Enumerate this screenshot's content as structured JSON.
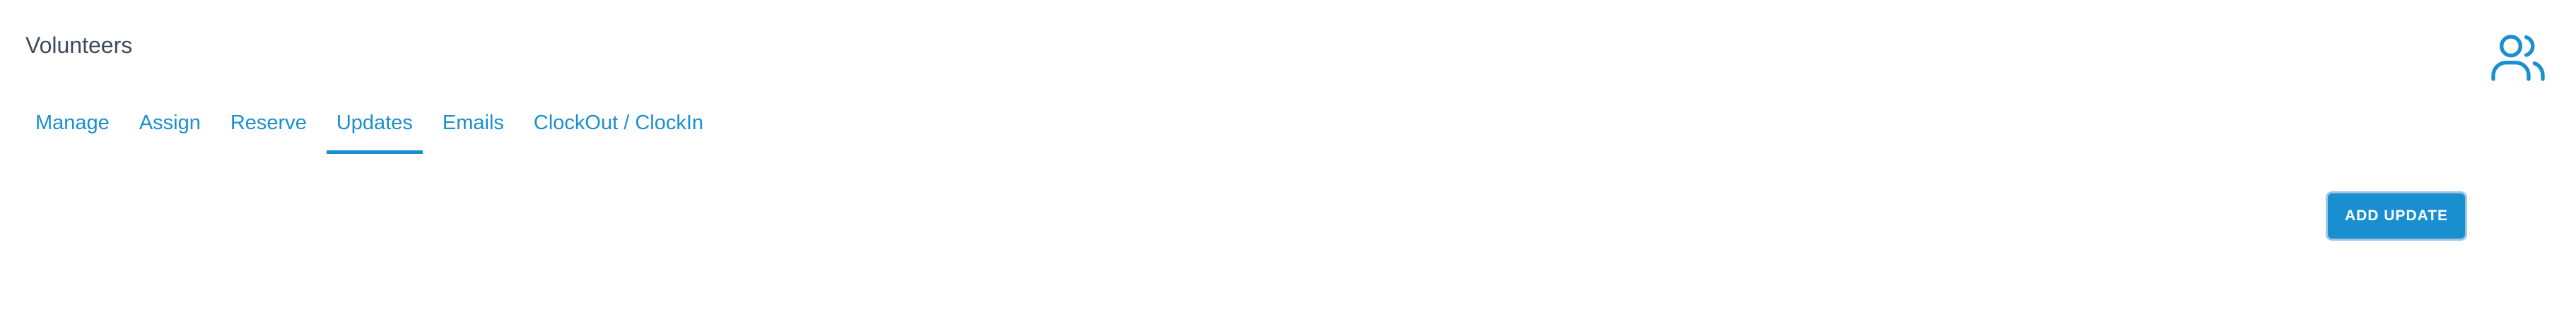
{
  "header": {
    "title": "Volunteers",
    "icon": "users-icon",
    "accent_color": "#1a8fd0"
  },
  "tabs": [
    {
      "label": "Manage",
      "active": false
    },
    {
      "label": "Assign",
      "active": false
    },
    {
      "label": "Reserve",
      "active": false
    },
    {
      "label": "Updates",
      "active": true
    },
    {
      "label": "Emails",
      "active": false
    },
    {
      "label": "ClockOut / ClockIn",
      "active": false
    }
  ],
  "actions": {
    "add_update_label": "ADD UPDATE"
  }
}
